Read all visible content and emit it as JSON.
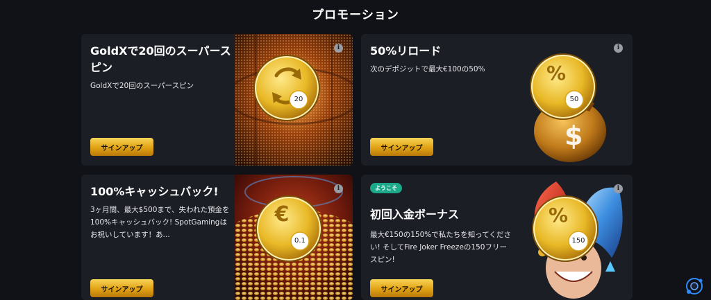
{
  "page": {
    "title": "プロモーション"
  },
  "promotions": [
    {
      "title": "GoldXで20回のスーパースピン",
      "description": "GoldXで20回のスーパースピン",
      "button_label": "サインアップ",
      "coin_icon": "refresh-icon",
      "coin_value": "20",
      "info_icon": "i"
    },
    {
      "title": "50%リロード",
      "description": "次のデポジットで最大€100の50%",
      "button_label": "サインアップ",
      "coin_icon": "percent-icon",
      "coin_symbol": "%",
      "coin_value": "50",
      "info_icon": "i"
    },
    {
      "title": "100%キャッシュバック!",
      "description": "3ヶ月間、最大$500まで、失われた預金を100%キャッシュバック! SpotGamingはお祝いしています！あ...",
      "button_label": "サインアップ",
      "coin_icon": "euro-icon",
      "coin_symbol": "€",
      "coin_value": "0.1",
      "info_icon": "i"
    },
    {
      "badge": "ようこそ",
      "title": "初回入金ボーナス",
      "description": "最大€150の150%で私たちを知ってください! そしてFire Joker Freezeの150フリースピン!",
      "button_label": "サインアップ",
      "coin_icon": "percent-icon",
      "coin_symbol": "%",
      "coin_value": "150",
      "info_icon": "i"
    }
  ],
  "colors": {
    "background": "#111217",
    "card": "#1c1e26",
    "button_gold": "#e1a215",
    "badge_green": "#1ba98a"
  }
}
